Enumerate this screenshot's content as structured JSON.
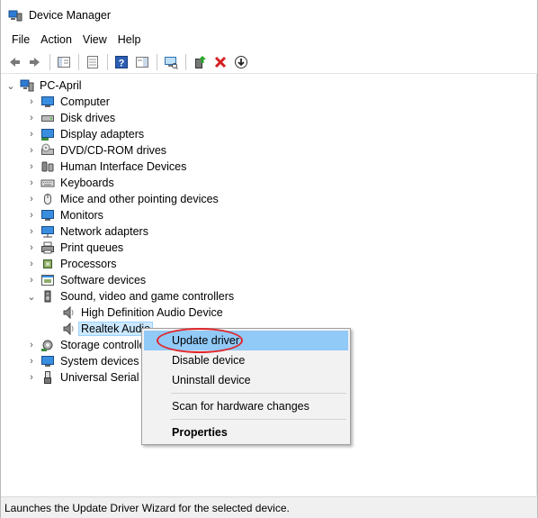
{
  "window": {
    "title": "Device Manager"
  },
  "menu": [
    "File",
    "Action",
    "View",
    "Help"
  ],
  "toolbar": {
    "icons": [
      "back-icon",
      "forward-icon",
      "show-hide-tree-icon",
      "properties-icon",
      "help-icon",
      "action-pane-icon",
      "scan-hardware-icon",
      "update-driver-icon",
      "uninstall-icon",
      "disable-icon"
    ]
  },
  "tree": {
    "root": "PC-April",
    "categories": [
      "Computer",
      "Disk drives",
      "Display adapters",
      "DVD/CD-ROM drives",
      "Human Interface Devices",
      "Keyboards",
      "Mice and other pointing devices",
      "Monitors",
      "Network adapters",
      "Print queues",
      "Processors",
      "Software devices",
      "Sound, video and game controllers"
    ],
    "sound_children": [
      "High Definition Audio Device",
      "Realtek Audio"
    ],
    "after": [
      "Storage controlle",
      "System devices",
      "Universal Serial B"
    ]
  },
  "context_menu": {
    "update": "Update driver",
    "disable": "Disable device",
    "uninstall": "Uninstall device",
    "scan": "Scan for hardware changes",
    "properties": "Properties"
  },
  "status": "Launches the Update Driver Wizard for the selected device.",
  "colors": {
    "highlight": "#91c9f7",
    "selection": "#cce8ff",
    "annotation": "#e0262b"
  }
}
